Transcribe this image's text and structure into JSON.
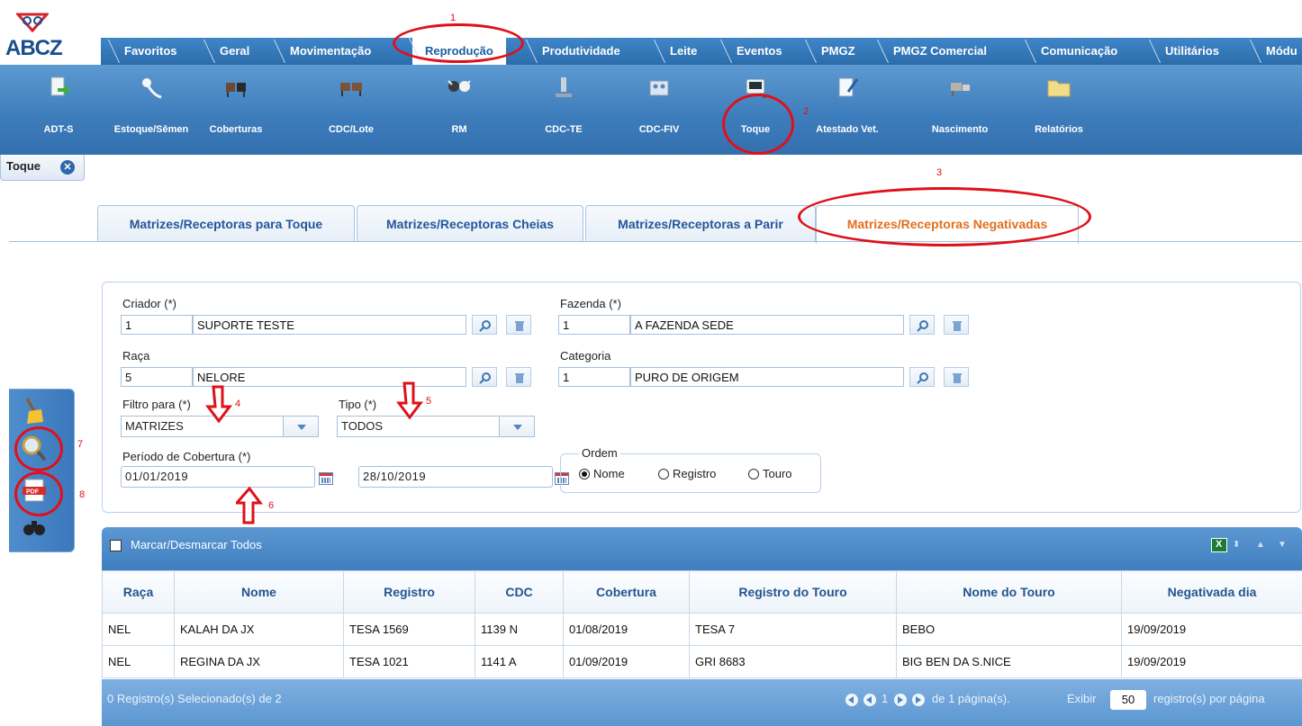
{
  "logo": {
    "text": "ABCZ"
  },
  "menu": [
    {
      "label": "Favoritos"
    },
    {
      "label": "Geral"
    },
    {
      "label": "Movimentação"
    },
    {
      "label": "Reprodução"
    },
    {
      "label": "Produtividade"
    },
    {
      "label": "Leite"
    },
    {
      "label": "Eventos"
    },
    {
      "label": "PMGZ"
    },
    {
      "label": "PMGZ Comercial"
    },
    {
      "label": "Comunicação"
    },
    {
      "label": "Utilitários"
    },
    {
      "label": "Módu"
    }
  ],
  "toolbar": [
    {
      "label": "ADT-S"
    },
    {
      "label": "Estoque/Sêmen"
    },
    {
      "label": "Coberturas"
    },
    {
      "label": "CDC/Lote"
    },
    {
      "label": "RM"
    },
    {
      "label": "CDC-TE"
    },
    {
      "label": "CDC-FIV"
    },
    {
      "label": "Toque"
    },
    {
      "label": "Atestado Vet."
    },
    {
      "label": "Nascimento"
    },
    {
      "label": "Relatórios"
    }
  ],
  "doc_tab": {
    "label": "Toque"
  },
  "tabs": [
    {
      "label": "Matrizes/Receptoras para Toque"
    },
    {
      "label": "Matrizes/Receptoras Cheias"
    },
    {
      "label": "Matrizes/Receptoras a Parir"
    },
    {
      "label": "Matrizes/Receptoras Negativadas"
    }
  ],
  "form": {
    "criador": {
      "label": "Criador (*)",
      "code": "1",
      "name": "SUPORTE TESTE"
    },
    "fazenda": {
      "label": "Fazenda (*)",
      "code": "1",
      "name": "A FAZENDA SEDE"
    },
    "raca": {
      "label": "Raça",
      "code": "5",
      "name": "NELORE"
    },
    "categoria": {
      "label": "Categoria",
      "code": "1",
      "name": "PURO DE ORIGEM"
    },
    "filtro": {
      "label": "Filtro para (*)",
      "value": "MATRIZES"
    },
    "tipo": {
      "label": "Tipo (*)",
      "value": "TODOS"
    },
    "periodo": {
      "label": "Período de Cobertura (*)",
      "from": "01/01/2019",
      "to": "28/10/2019"
    },
    "ordem": {
      "label": "Ordem",
      "options": [
        "Nome",
        "Registro",
        "Touro"
      ],
      "selected": "Nome"
    }
  },
  "grid": {
    "select_all_label": "Marcar/Desmarcar Todos",
    "columns": [
      "Raça",
      "Nome",
      "Registro",
      "CDC",
      "Cobertura",
      "Registro do Touro",
      "Nome do Touro",
      "Negativada dia"
    ],
    "rows": [
      [
        "NEL",
        "KALAH DA JX",
        "TESA 1569",
        "1139 N",
        "01/08/2019",
        "TESA 7",
        "BEBO",
        "19/09/2019"
      ],
      [
        "NEL",
        "REGINA DA JX",
        "TESA 1021",
        "1141 A",
        "01/09/2019",
        "GRI 8683",
        "BIG BEN DA S.NICE",
        "19/09/2019"
      ]
    ],
    "footer": {
      "selected_text": "0 Registro(s) Selecionado(s) de 2",
      "page": "1",
      "pages_text": "de 1 página(s).",
      "show_label": "Exibir",
      "page_size": "50",
      "per_page_label": "registro(s) por página"
    }
  },
  "annotations": [
    "1",
    "2",
    "3",
    "4",
    "5",
    "6",
    "7",
    "8"
  ],
  "colors": {
    "accent": "#2c6cab",
    "active_tab": "#e26f1c",
    "annotation": "#e0101a"
  }
}
